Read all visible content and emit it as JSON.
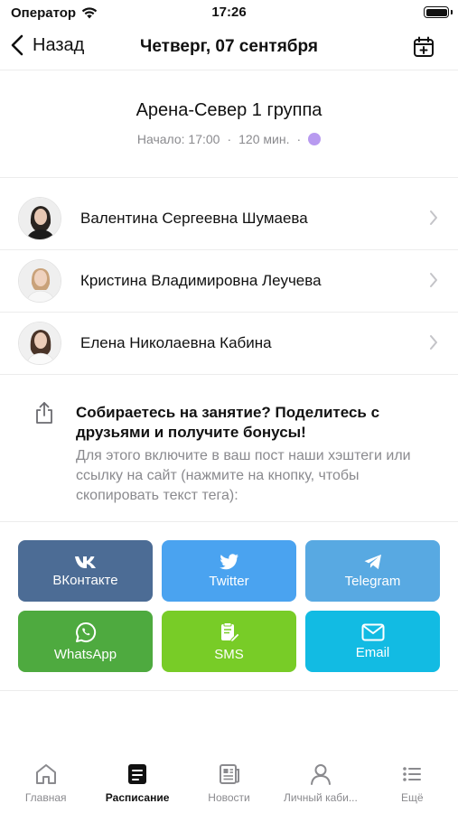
{
  "status_bar": {
    "carrier": "Оператор",
    "time": "17:26"
  },
  "nav": {
    "back_label": "Назад",
    "title": "Четверг, 07 сентября"
  },
  "class_info": {
    "name": "Арена-Север 1 группа",
    "start": "Начало: 17:00",
    "separator": "·",
    "duration": "120 мин.",
    "color": "#b89af0"
  },
  "trainers": [
    {
      "name": "Валентина Сергеевна Шумаева"
    },
    {
      "name": "Кристина Владимировна Леучева"
    },
    {
      "name": "Елена Николаевна Кабина"
    }
  ],
  "share": {
    "title": "Собираетесь на занятие? Поделитесь с друзьями и получите бонусы!",
    "description": "Для этого включите в ваш пост наши хэштеги или ссылку на сайт (нажмите на кнопку, чтобы скопировать текст тега):",
    "buttons": [
      {
        "label": "ВКонтакте",
        "icon": "vk-icon",
        "color": "#4c6c95"
      },
      {
        "label": "Twitter",
        "icon": "twitter-icon",
        "color": "#4aa3f0"
      },
      {
        "label": "Telegram",
        "icon": "telegram-icon",
        "color": "#58a9e2"
      },
      {
        "label": "WhatsApp",
        "icon": "whatsapp-icon",
        "color": "#4eaa3f"
      },
      {
        "label": "SMS",
        "icon": "sms-icon",
        "color": "#78cc27"
      },
      {
        "label": "Email",
        "icon": "email-icon",
        "color": "#12bbe3"
      }
    ]
  },
  "tab_bar": {
    "items": [
      {
        "label": "Главная",
        "icon": "home-icon"
      },
      {
        "label": "Расписание",
        "icon": "schedule-icon",
        "active": true
      },
      {
        "label": "Новости",
        "icon": "news-icon"
      },
      {
        "label": "Личный каби...",
        "icon": "profile-icon"
      },
      {
        "label": "Ещё",
        "icon": "more-icon"
      }
    ]
  }
}
